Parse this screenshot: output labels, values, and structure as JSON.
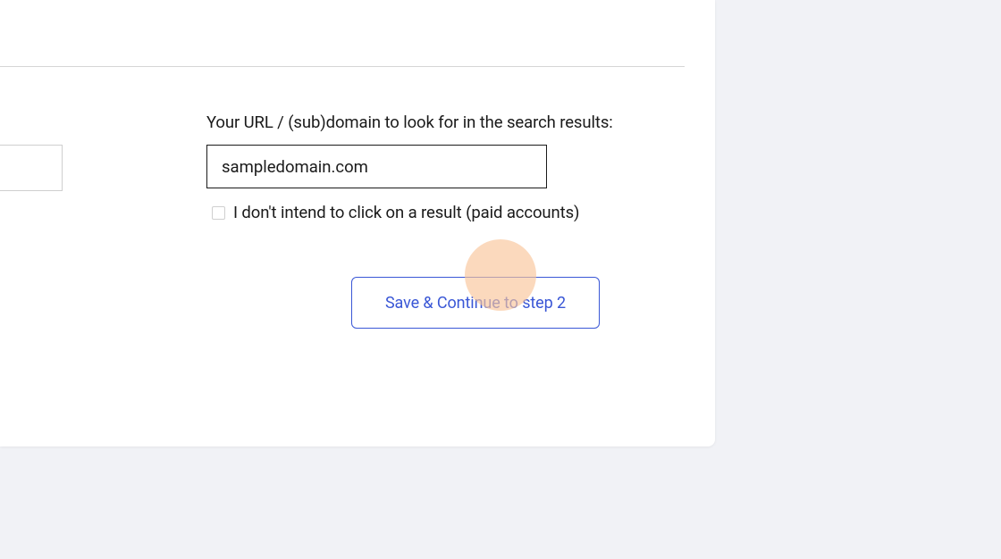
{
  "form": {
    "url_label": "Your URL / (sub)domain to look for in the search results:",
    "url_value": "sampledomain.com",
    "dont_click_label": "I don't intend to click on a result (paid accounts)",
    "dont_click_checked": false
  },
  "actions": {
    "continue_label": "Save & Continue to step 2"
  },
  "side_input": {
    "value": ""
  }
}
